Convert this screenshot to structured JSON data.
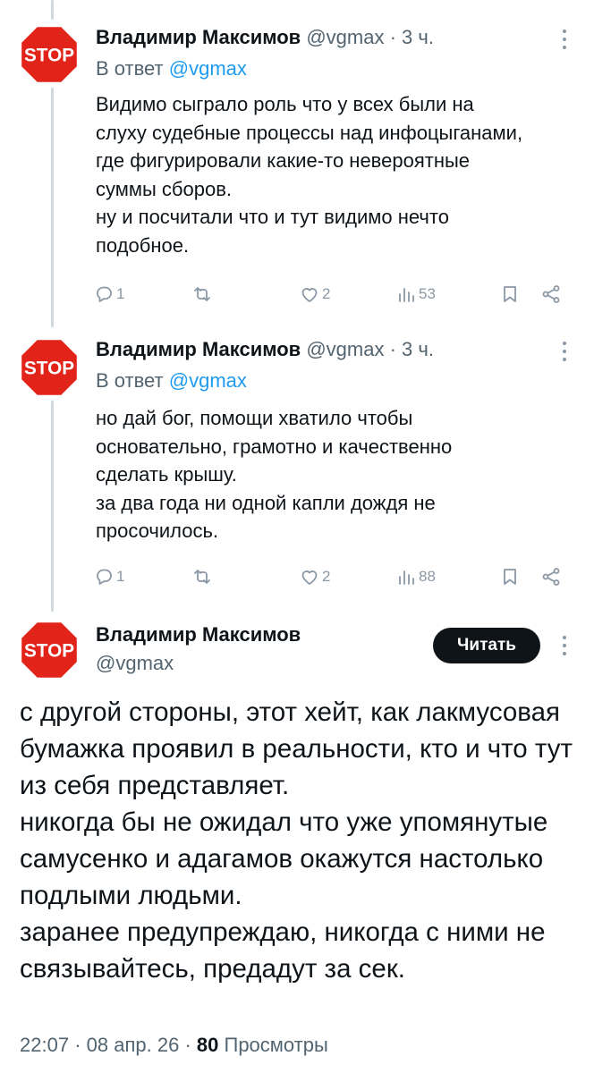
{
  "avatar_text": "STOP",
  "colors": {
    "accent": "#1d9bf0",
    "stop_sign": "#e2231a",
    "muted": "#536471"
  },
  "tweets": [
    {
      "author": "Владимир Максимов",
      "handle": "@vgmax",
      "separator": "·",
      "time": "3 ч.",
      "reply_prefix": "В ответ",
      "reply_mention": "@vgmax",
      "text": "Видимо сыграло роль что у всех были на слуху судебные процессы над инфоцыганами, где фигурировали какие-то невероятные суммы сборов.\nну и посчитали что и тут видимо нечто подобное.",
      "replies": "1",
      "likes": "2",
      "views": "53"
    },
    {
      "author": "Владимир Максимов",
      "handle": "@vgmax",
      "separator": "·",
      "time": "3 ч.",
      "reply_prefix": "В ответ",
      "reply_mention": "@vgmax",
      "text": "но дай бог, помощи хватило чтобы основательно, грамотно и качественно сделать крышу.\nза два года ни одной капли дождя не просочилось.",
      "replies": "1",
      "likes": "2",
      "views": "88"
    }
  ],
  "main": {
    "author": "Владимир Максимов",
    "handle": "@vgmax",
    "follow_label": "Читать",
    "text": "с другой стороны, этот хейт, как лакмусовая бумажка проявил в реальности, кто и что тут из себя представляет.\nникогда бы не ожидал что уже упомянутые  самусенко и адагамов окажутся настолько подлыми людьми.\nзаранее предупреждаю, никогда с ними не связывайтесь, предадут за сек.",
    "time": "22:07",
    "separator": "·",
    "date": "08 апр. 26",
    "views_count": "80",
    "views_label": "Просмотры"
  },
  "icons": [
    "reply-icon",
    "retweet-icon",
    "like-icon",
    "views-icon",
    "bookmark-icon",
    "share-icon",
    "more-icon"
  ]
}
